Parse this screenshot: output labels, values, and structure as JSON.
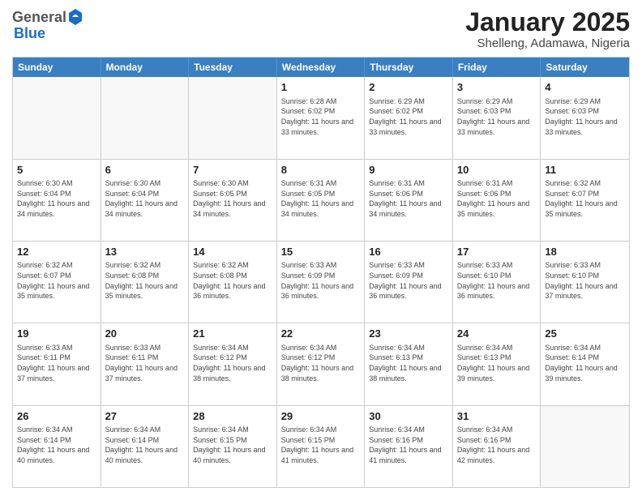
{
  "header": {
    "logo_general": "General",
    "logo_blue": "Blue",
    "month_title": "January 2025",
    "location": "Shelleng, Adamawa, Nigeria"
  },
  "weekdays": [
    "Sunday",
    "Monday",
    "Tuesday",
    "Wednesday",
    "Thursday",
    "Friday",
    "Saturday"
  ],
  "rows": [
    [
      {
        "day": "",
        "empty": true
      },
      {
        "day": "",
        "empty": true
      },
      {
        "day": "",
        "empty": true
      },
      {
        "day": "1",
        "sunrise": "6:28 AM",
        "sunset": "6:02 PM",
        "daylight": "11 hours and 33 minutes."
      },
      {
        "day": "2",
        "sunrise": "6:29 AM",
        "sunset": "6:02 PM",
        "daylight": "11 hours and 33 minutes."
      },
      {
        "day": "3",
        "sunrise": "6:29 AM",
        "sunset": "6:03 PM",
        "daylight": "11 hours and 33 minutes."
      },
      {
        "day": "4",
        "sunrise": "6:29 AM",
        "sunset": "6:03 PM",
        "daylight": "11 hours and 33 minutes."
      }
    ],
    [
      {
        "day": "5",
        "sunrise": "6:30 AM",
        "sunset": "6:04 PM",
        "daylight": "11 hours and 34 minutes."
      },
      {
        "day": "6",
        "sunrise": "6:30 AM",
        "sunset": "6:04 PM",
        "daylight": "11 hours and 34 minutes."
      },
      {
        "day": "7",
        "sunrise": "6:30 AM",
        "sunset": "6:05 PM",
        "daylight": "11 hours and 34 minutes."
      },
      {
        "day": "8",
        "sunrise": "6:31 AM",
        "sunset": "6:05 PM",
        "daylight": "11 hours and 34 minutes."
      },
      {
        "day": "9",
        "sunrise": "6:31 AM",
        "sunset": "6:06 PM",
        "daylight": "11 hours and 34 minutes."
      },
      {
        "day": "10",
        "sunrise": "6:31 AM",
        "sunset": "6:06 PM",
        "daylight": "11 hours and 35 minutes."
      },
      {
        "day": "11",
        "sunrise": "6:32 AM",
        "sunset": "6:07 PM",
        "daylight": "11 hours and 35 minutes."
      }
    ],
    [
      {
        "day": "12",
        "sunrise": "6:32 AM",
        "sunset": "6:07 PM",
        "daylight": "11 hours and 35 minutes."
      },
      {
        "day": "13",
        "sunrise": "6:32 AM",
        "sunset": "6:08 PM",
        "daylight": "11 hours and 35 minutes."
      },
      {
        "day": "14",
        "sunrise": "6:32 AM",
        "sunset": "6:08 PM",
        "daylight": "11 hours and 36 minutes."
      },
      {
        "day": "15",
        "sunrise": "6:33 AM",
        "sunset": "6:09 PM",
        "daylight": "11 hours and 36 minutes."
      },
      {
        "day": "16",
        "sunrise": "6:33 AM",
        "sunset": "6:09 PM",
        "daylight": "11 hours and 36 minutes."
      },
      {
        "day": "17",
        "sunrise": "6:33 AM",
        "sunset": "6:10 PM",
        "daylight": "11 hours and 36 minutes."
      },
      {
        "day": "18",
        "sunrise": "6:33 AM",
        "sunset": "6:10 PM",
        "daylight": "11 hours and 37 minutes."
      }
    ],
    [
      {
        "day": "19",
        "sunrise": "6:33 AM",
        "sunset": "6:11 PM",
        "daylight": "11 hours and 37 minutes."
      },
      {
        "day": "20",
        "sunrise": "6:33 AM",
        "sunset": "6:11 PM",
        "daylight": "11 hours and 37 minutes."
      },
      {
        "day": "21",
        "sunrise": "6:34 AM",
        "sunset": "6:12 PM",
        "daylight": "11 hours and 38 minutes."
      },
      {
        "day": "22",
        "sunrise": "6:34 AM",
        "sunset": "6:12 PM",
        "daylight": "11 hours and 38 minutes."
      },
      {
        "day": "23",
        "sunrise": "6:34 AM",
        "sunset": "6:13 PM",
        "daylight": "11 hours and 38 minutes."
      },
      {
        "day": "24",
        "sunrise": "6:34 AM",
        "sunset": "6:13 PM",
        "daylight": "11 hours and 39 minutes."
      },
      {
        "day": "25",
        "sunrise": "6:34 AM",
        "sunset": "6:14 PM",
        "daylight": "11 hours and 39 minutes."
      }
    ],
    [
      {
        "day": "26",
        "sunrise": "6:34 AM",
        "sunset": "6:14 PM",
        "daylight": "11 hours and 40 minutes."
      },
      {
        "day": "27",
        "sunrise": "6:34 AM",
        "sunset": "6:14 PM",
        "daylight": "11 hours and 40 minutes."
      },
      {
        "day": "28",
        "sunrise": "6:34 AM",
        "sunset": "6:15 PM",
        "daylight": "11 hours and 40 minutes."
      },
      {
        "day": "29",
        "sunrise": "6:34 AM",
        "sunset": "6:15 PM",
        "daylight": "11 hours and 41 minutes."
      },
      {
        "day": "30",
        "sunrise": "6:34 AM",
        "sunset": "6:16 PM",
        "daylight": "11 hours and 41 minutes."
      },
      {
        "day": "31",
        "sunrise": "6:34 AM",
        "sunset": "6:16 PM",
        "daylight": "11 hours and 42 minutes."
      },
      {
        "day": "",
        "empty": true
      }
    ]
  ]
}
